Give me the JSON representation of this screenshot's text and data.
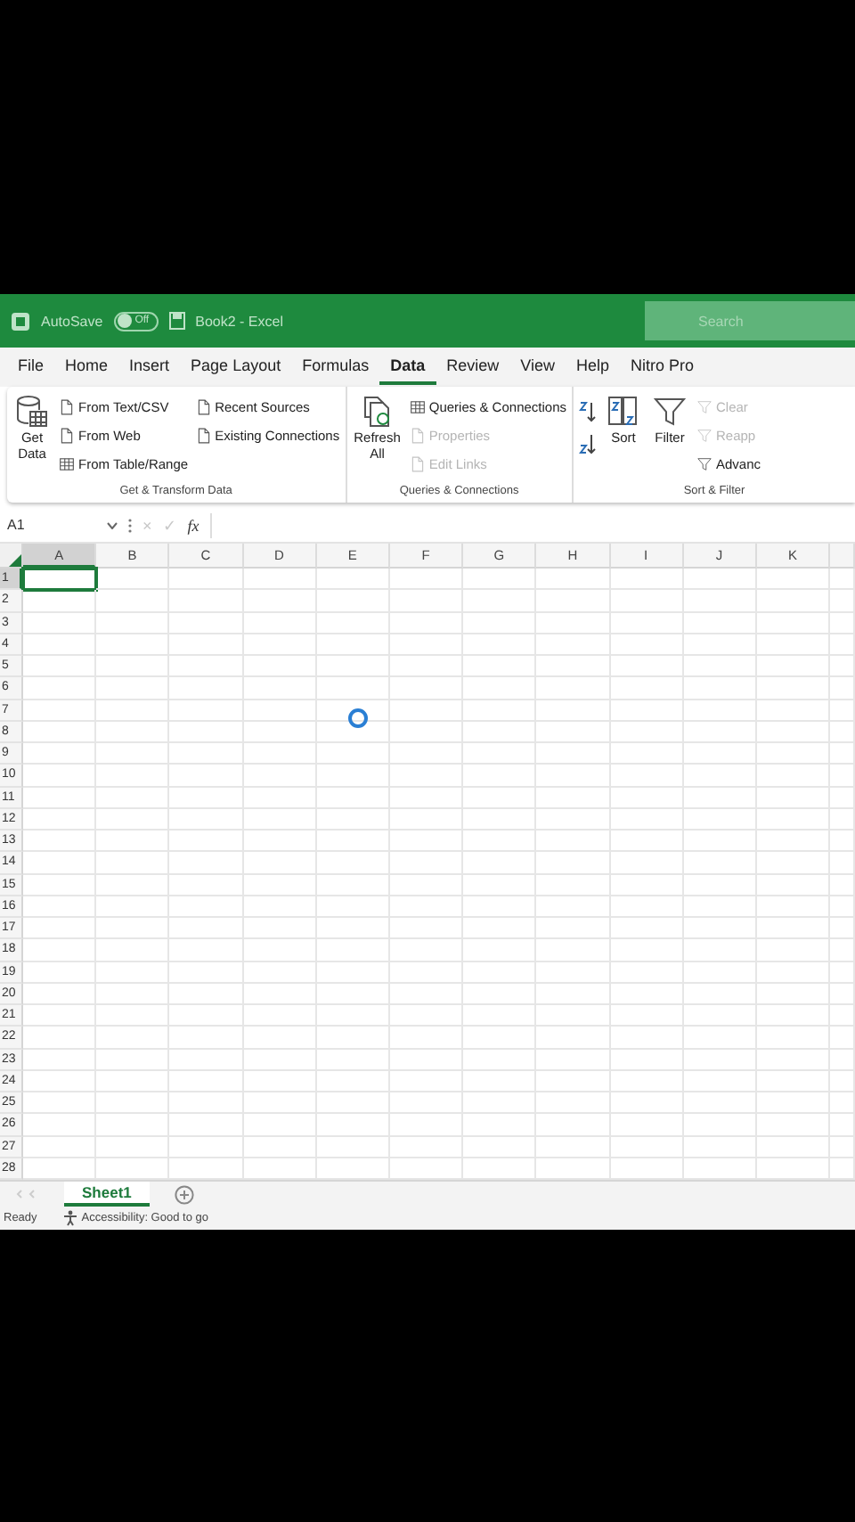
{
  "title_bar": {
    "autosave_label": "AutoSave",
    "autosave_toggle": {
      "label": "Off",
      "on": false
    },
    "document_title": "Book2 - Excel",
    "search": {
      "placeholder": "Search"
    }
  },
  "menu": [
    {
      "label": "File",
      "selected": false
    },
    {
      "label": "Home",
      "selected": false
    },
    {
      "label": "Insert",
      "selected": false
    },
    {
      "label": "Page Layout",
      "selected": false
    },
    {
      "label": "Formulas",
      "selected": false
    },
    {
      "label": "Data",
      "selected": true
    },
    {
      "label": "Review",
      "selected": false
    },
    {
      "label": "View",
      "selected": false
    },
    {
      "label": "Help",
      "selected": false
    },
    {
      "label": "Nitro Pro",
      "selected": false
    }
  ],
  "ribbon": [
    {
      "label": "Get & Transform Data",
      "columns": [
        {
          "kind": "large",
          "lines": [
            "Get",
            "Data"
          ]
        },
        {
          "kind": "stack",
          "items": [
            {
              "label": "From Text/CSV",
              "disabled": false
            },
            {
              "label": "From Web",
              "disabled": false
            },
            {
              "label": "From Table/Range",
              "disabled": false
            }
          ]
        },
        {
          "kind": "stack",
          "items": [
            {
              "label": "Recent Sources",
              "disabled": false
            },
            {
              "label": "Existing Connections",
              "disabled": false
            }
          ]
        }
      ]
    },
    {
      "label": "Queries & Connections",
      "columns": [
        {
          "kind": "large",
          "lines": [
            "Refresh",
            "All"
          ]
        },
        {
          "kind": "stack",
          "items": [
            {
              "label": "Queries & Connections",
              "disabled": false
            },
            {
              "label": "Properties",
              "disabled": true
            },
            {
              "label": "Edit Links",
              "disabled": true
            }
          ]
        }
      ]
    },
    {
      "label": "Sort & Filter",
      "columns": [
        {
          "kind": "sort"
        },
        {
          "kind": "large",
          "lines": [
            "Sort"
          ]
        },
        {
          "kind": "large",
          "lines": [
            "Filter"
          ]
        },
        {
          "kind": "stack",
          "items": [
            {
              "label": "Clear",
              "disabled": true
            },
            {
              "label": "Reapp",
              "disabled": true
            },
            {
              "label": "Advanc",
              "disabled": false
            }
          ]
        }
      ]
    }
  ],
  "formula_bar": {
    "name_box": "A1",
    "cancel": "×",
    "enter": "✓",
    "function": "fx"
  },
  "grid": {
    "columns": [
      {
        "label": "A",
        "selected": true
      },
      {
        "label": "B",
        "selected": false
      },
      {
        "label": "C",
        "selected": false
      },
      {
        "label": "D",
        "selected": false
      },
      {
        "label": "E",
        "selected": false
      },
      {
        "label": "F",
        "selected": false
      },
      {
        "label": "G",
        "selected": false
      },
      {
        "label": "H",
        "selected": false
      },
      {
        "label": "I",
        "selected": false
      },
      {
        "label": "J",
        "selected": false
      },
      {
        "label": "K",
        "selected": false
      }
    ],
    "rows": [
      {
        "label": "1",
        "selected": true
      },
      {
        "label": "2",
        "selected": false
      },
      {
        "label": "3",
        "selected": false
      },
      {
        "label": "4",
        "selected": false
      },
      {
        "label": "5",
        "selected": false
      },
      {
        "label": "6",
        "selected": false
      },
      {
        "label": "7",
        "selected": false
      },
      {
        "label": "8",
        "selected": false
      },
      {
        "label": "9",
        "selected": false
      },
      {
        "label": "10",
        "selected": false
      },
      {
        "label": "11",
        "selected": false
      },
      {
        "label": "12",
        "selected": false
      },
      {
        "label": "13",
        "selected": false
      },
      {
        "label": "14",
        "selected": false
      },
      {
        "label": "15",
        "selected": false
      },
      {
        "label": "16",
        "selected": false
      },
      {
        "label": "17",
        "selected": false
      },
      {
        "label": "18",
        "selected": false
      },
      {
        "label": "19",
        "selected": false
      },
      {
        "label": "20",
        "selected": false
      },
      {
        "label": "21",
        "selected": false
      },
      {
        "label": "22",
        "selected": false
      },
      {
        "label": "23",
        "selected": false
      },
      {
        "label": "24",
        "selected": false
      },
      {
        "label": "25",
        "selected": false
      },
      {
        "label": "26",
        "selected": false
      },
      {
        "label": "27",
        "selected": false
      },
      {
        "label": "28",
        "selected": false
      }
    ],
    "loading": true
  },
  "sheet_tabs": [
    {
      "label": "Sheet1",
      "selected": true
    }
  ],
  "status_bar": {
    "mode": "Ready",
    "accessibility": "Accessibility: Good to go"
  }
}
